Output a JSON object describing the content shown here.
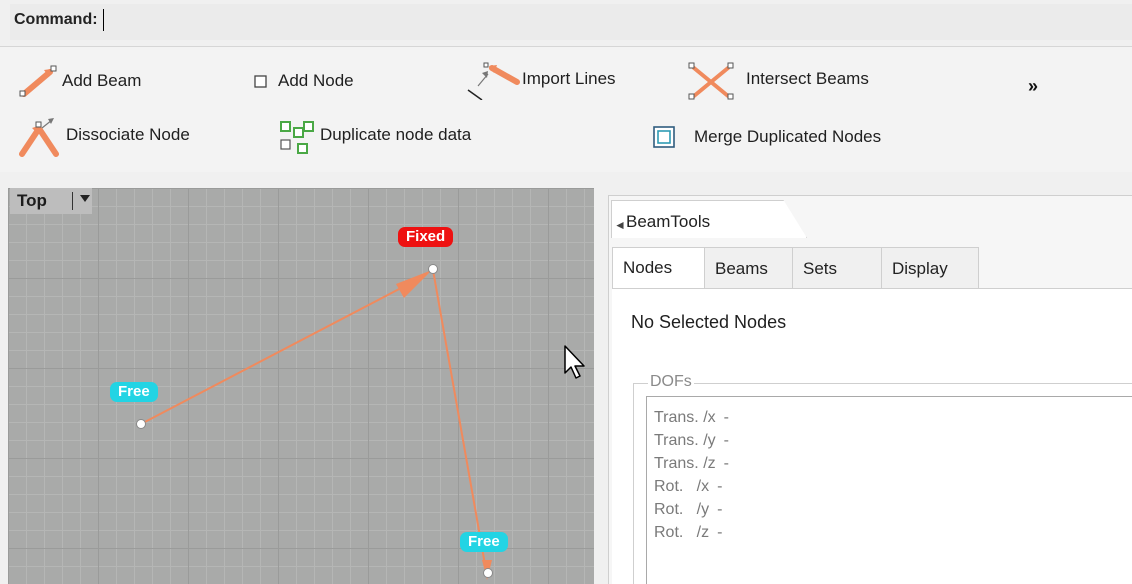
{
  "command": {
    "label": "Command:"
  },
  "toolbar": {
    "row1": [
      {
        "id": "add-beam",
        "label": "Add Beam",
        "icon": "add-beam-icon"
      },
      {
        "id": "add-node",
        "label": "Add Node",
        "icon": "add-node-icon"
      },
      {
        "id": "import-lines",
        "label": "Import Lines",
        "icon": "import-lines-icon"
      },
      {
        "id": "intersect-beams",
        "label": "Intersect Beams",
        "icon": "intersect-beams-icon"
      }
    ],
    "row2": [
      {
        "id": "dissociate-node",
        "label": "Dissociate Node",
        "icon": "dissociate-node-icon"
      },
      {
        "id": "duplicate-node-data",
        "label": "Duplicate node data",
        "icon": "duplicate-node-data-icon"
      },
      {
        "id": "merge-duplicated-nodes",
        "label": "Merge Duplicated Nodes",
        "icon": "merge-duplicated-nodes-icon"
      }
    ],
    "overflow": "»"
  },
  "viewport": {
    "name": "Top",
    "nodes": [
      {
        "tag": "Fixed",
        "status": "fixed"
      },
      {
        "tag": "Free",
        "status": "free"
      },
      {
        "tag": "Free",
        "status": "free"
      }
    ],
    "beam_color": "#f08a5d",
    "fixed_color": "#ee1111",
    "free_color": "#22d4e4"
  },
  "panel": {
    "title": "BeamTools",
    "tabs": [
      "Nodes",
      "Beams",
      "Sets",
      "Display"
    ],
    "active_tab": "Nodes",
    "selection_status": "No Selected Nodes",
    "dofs": {
      "legend": "DOFs",
      "rows": [
        {
          "label": "Trans. /x",
          "value": "-"
        },
        {
          "label": "Trans. /y",
          "value": "-"
        },
        {
          "label": "Trans. /z",
          "value": "-"
        },
        {
          "label": "Rot.   /x",
          "value": "-"
        },
        {
          "label": "Rot.   /y",
          "value": "-"
        },
        {
          "label": "Rot.   /z",
          "value": "-"
        }
      ]
    }
  }
}
